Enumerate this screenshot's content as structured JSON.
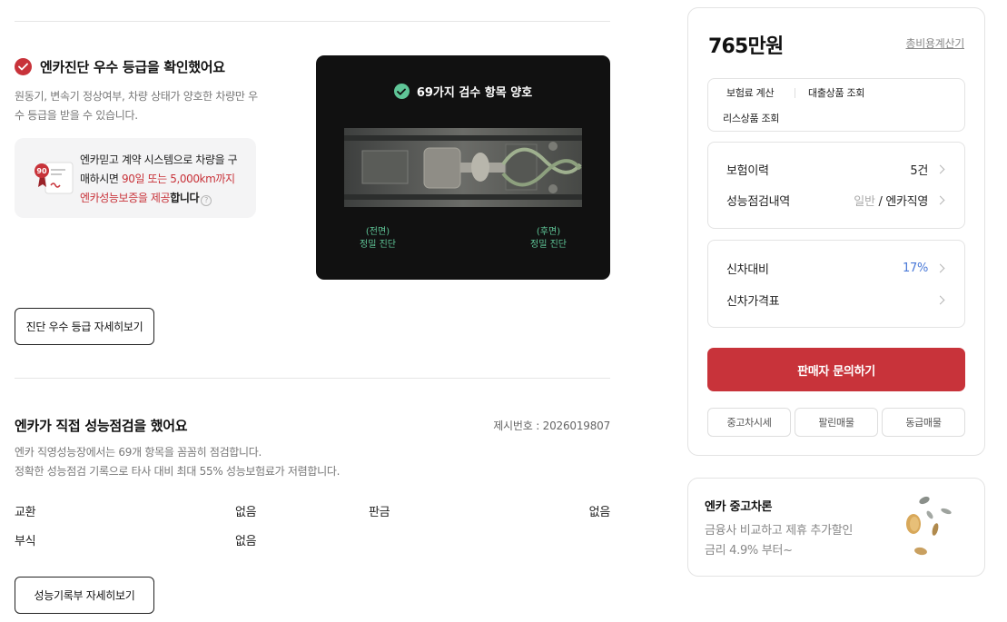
{
  "diagnosis": {
    "title": "엔카진단 우수 등급을 확인했어요",
    "desc_line1": "원동기, 변속기 정상여부, 차량 상태가 양호한 차량만 우",
    "desc_line2": "수 등급을 받을 수 있습니다.",
    "promo": {
      "badge": "90",
      "line1": "엔카믿고 계약 시스템으로 차량을 구",
      "line2_a": "매하시면 ",
      "line2_b": "90일 또는 5,000km까지",
      "line3_a": "엔카성능보증을 제공",
      "line3_b": "합니다",
      "help_glyph": "?"
    },
    "card": {
      "title": "69가지 검수 항목 양호",
      "front_a": "(전면)",
      "front_b": "정밀 진단",
      "rear_a": "(후면)",
      "rear_b": "정밀 진단"
    },
    "detail_button": "진단 우수 등급 자세히보기"
  },
  "inspection": {
    "title": "엔카가 직접 성능점검을 했어요",
    "presentation_no": "제시번호 : 2026019807",
    "desc_line1": "엔카 직영성능장에서는 69개 항목을 꼼꼼히 점검합니다.",
    "desc_line2": "정확한 성능점검 기록으로 타사 대비 최대 55% 성능보험료가 저렴합니다.",
    "rows": [
      {
        "label": "교환",
        "value": "없음",
        "label2": "판금",
        "value2": "없음"
      },
      {
        "label": "부식",
        "value": "없음"
      }
    ],
    "detail_button": "성능기록부 자세히보기"
  },
  "sidebar": {
    "price": "765만원",
    "calc_link": "총비용계산기",
    "chips": [
      "보험료 계산",
      "대출상품 조회",
      "리스상품 조회"
    ],
    "history": [
      {
        "label": "보험이력",
        "value": "5건"
      },
      {
        "label": "성능점검내역",
        "value_muted": "일반",
        "value_sep": " / ",
        "value": "엔카직영"
      }
    ],
    "newcar": [
      {
        "label": "신차대비",
        "value": "17%"
      },
      {
        "label": "신차가격표",
        "value": ""
      }
    ],
    "cta": "판매자 문의하기",
    "pills": [
      "중고차시세",
      "팔린매물",
      "동급매물"
    ]
  },
  "loan": {
    "title": "엔카 중고차론",
    "line1": "금융사 비교하고 제휴 추가할인",
    "line2": "금리 4.9% 부터~"
  },
  "colors": {
    "accent_red": "#c8333a",
    "accent_green": "#5fc597",
    "accent_blue": "#4a79d8",
    "dark_card": "#111111"
  }
}
